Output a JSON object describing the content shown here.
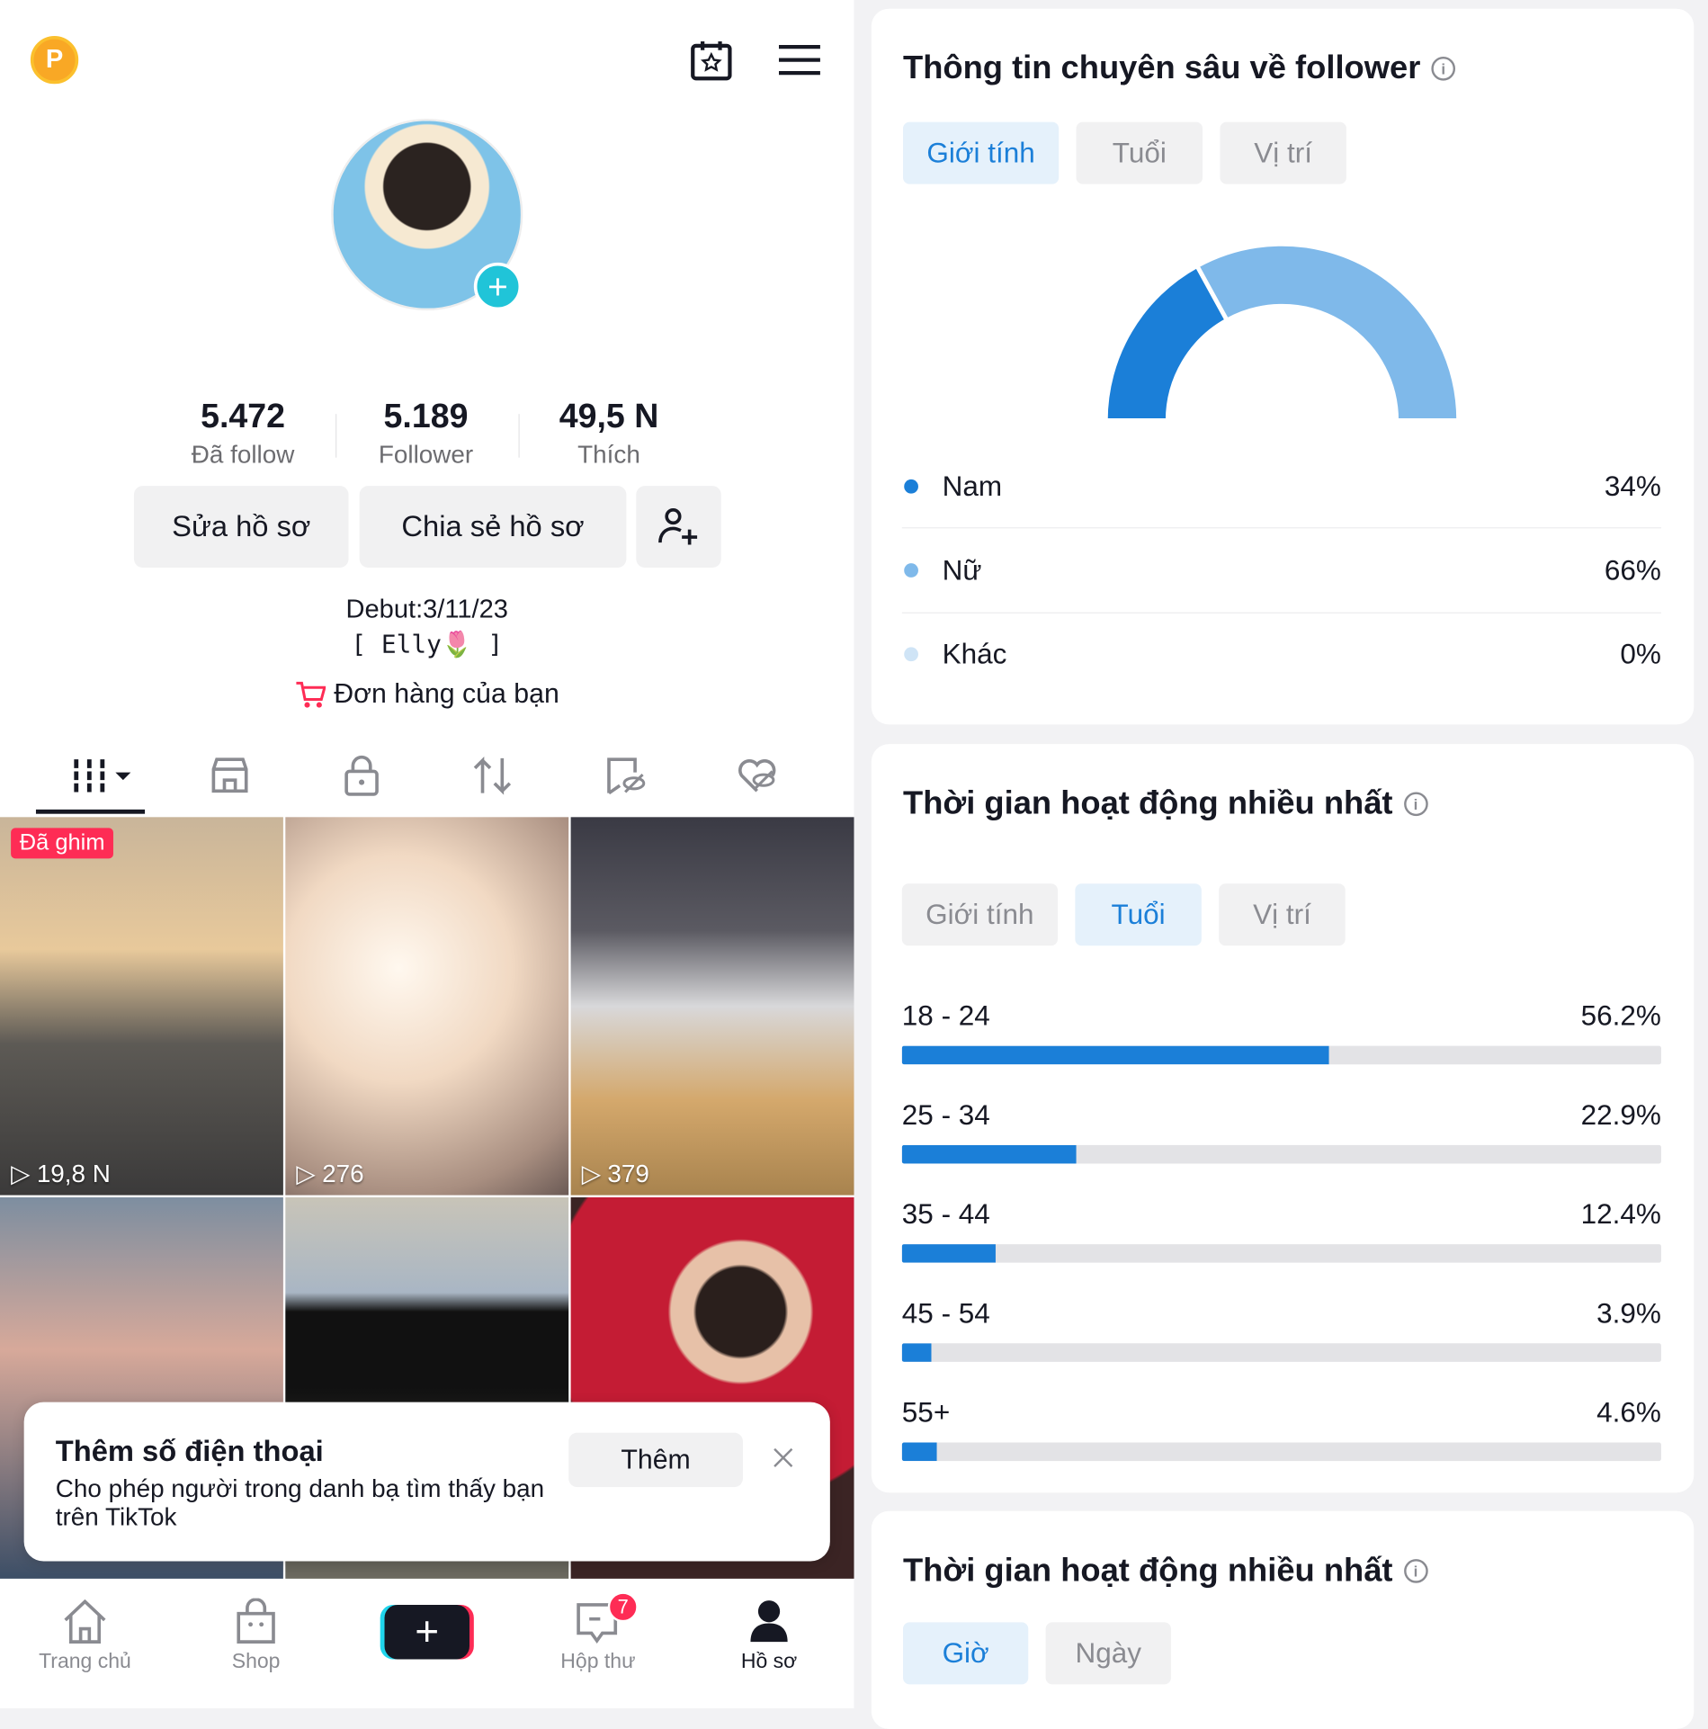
{
  "profile": {
    "coin_label": "P",
    "stats": [
      {
        "value": "5.472",
        "label": "Đã follow"
      },
      {
        "value": "5.189",
        "label": "Follower"
      },
      {
        "value": "49,5 N",
        "label": "Thích"
      }
    ],
    "edit_button": "Sửa hồ sơ",
    "share_button": "Chia sẻ hồ sơ",
    "bio_line1": "Debut:3/11/23",
    "bio_line2": "[ Elly🌷 ]",
    "orders_link": "Đơn hàng của bạn",
    "pinned_badge": "Đã ghim",
    "videos": [
      {
        "views": "19,8 N"
      },
      {
        "views": "276"
      },
      {
        "views": "379"
      },
      {},
      {},
      {}
    ]
  },
  "popup": {
    "title": "Thêm số điện thoại",
    "body": "Cho phép người trong danh bạ tìm thấy bạn trên TikTok",
    "add_button": "Thêm"
  },
  "bottom_nav": [
    {
      "label": "Trang chủ"
    },
    {
      "label": "Shop"
    },
    {
      "label": ""
    },
    {
      "label": "Hộp thư",
      "badge": "7"
    },
    {
      "label": "Hồ sơ"
    }
  ],
  "insights": {
    "title": "Thông tin chuyên sâu về follower",
    "tabs": [
      "Giới tính",
      "Tuổi",
      "Vị trí"
    ],
    "active_tab": "Giới tính",
    "colors": {
      "accent": "#1b7fd8",
      "female": "#7fb9ea",
      "other": "#cfe4f6"
    }
  },
  "activity1": {
    "title": "Thời gian hoạt động nhiều nhất",
    "tabs": [
      "Giới tính",
      "Tuổi",
      "Vị trí"
    ],
    "active_tab": "Tuổi"
  },
  "activity2": {
    "title": "Thời gian hoạt động nhiều nhất",
    "tabs": [
      "Giờ",
      "Ngày"
    ],
    "active_tab": "Giờ"
  },
  "chart_data": [
    {
      "type": "pie",
      "subtype": "half-donut",
      "categories": [
        "Nam",
        "Nữ",
        "Khác"
      ],
      "labels": [
        "34%",
        "66%",
        "0%"
      ],
      "values": [
        34,
        66,
        0
      ]
    },
    {
      "type": "bar",
      "orientation": "horizontal",
      "categories": [
        "18 - 24",
        "25 - 34",
        "35 - 44",
        "45 - 54",
        "55+"
      ],
      "labels": [
        "56.2%",
        "22.9%",
        "12.4%",
        "3.9%",
        "4.6%"
      ],
      "values": [
        56.2,
        22.9,
        12.4,
        3.9,
        4.6
      ],
      "xlim": [
        0,
        100
      ]
    }
  ]
}
